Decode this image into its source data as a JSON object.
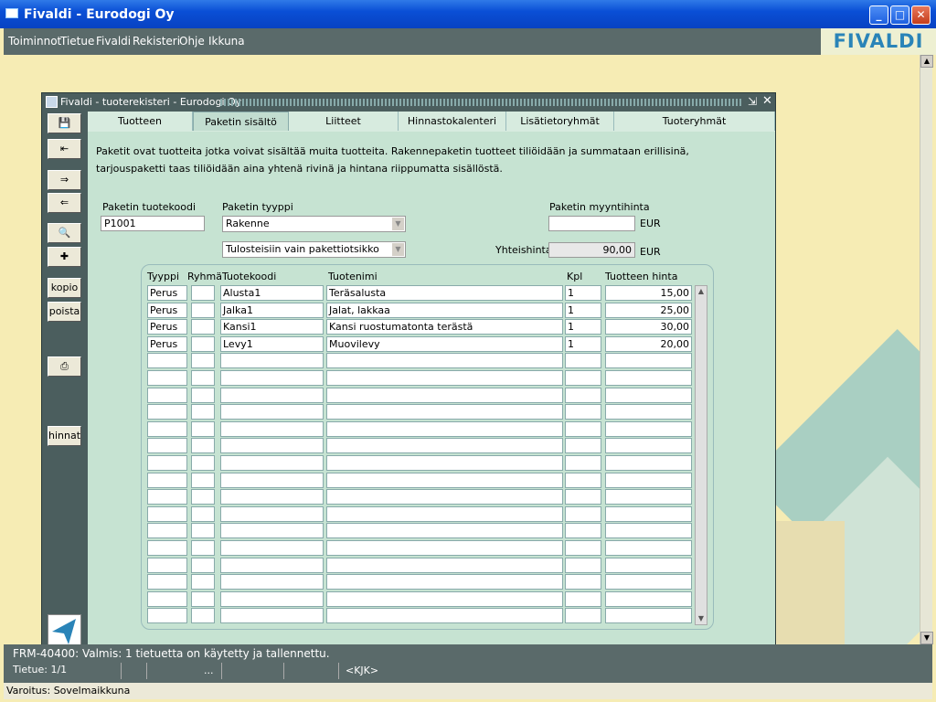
{
  "window": {
    "title": "Fivaldi - Eurodogi Oy",
    "minimize": "_",
    "maximize": "□",
    "close": "✕"
  },
  "menu": [
    "Toiminnot",
    "Tietue",
    "Fivaldi",
    "Rekisteri",
    "Ohje",
    "Ikkuna"
  ],
  "brand": {
    "logo": "FIVALDI"
  },
  "subwindow": {
    "title": "Fivaldi - tuoterekisteri - Eurodogi Oy"
  },
  "toolbar": {
    "copy": "kopio",
    "delete": "poista",
    "prices": "hinnat"
  },
  "tabs": [
    "Tuotteen perustiedot",
    "Paketin sisältö",
    "Liitteet",
    "Hinnastokalenteri",
    "Lisätietoryhmät",
    "Tuoteryhmät"
  ],
  "description": {
    "line1": "Paketit ovat tuotteita jotka voivat sisältää muita tuotteita. Rakennepaketin tuotteet tiliöidään ja summataan erillisinä,",
    "line2": "tarjouspaketti taas tiliöidään aina yhtenä rivinä ja hintana riippumatta sisällöstä."
  },
  "form": {
    "code_label": "Paketin tuotekoodi",
    "code_value": "P1001",
    "type_label": "Paketin tyyppi",
    "type_value": "Rakenne",
    "print_value": "Tulosteisiin vain pakettiotsikko",
    "sale_label": "Paketin myyntihinta",
    "sale_value": "",
    "currency": "EUR",
    "total_label": "Yhteishinta",
    "total_value": "90,00",
    "total_currency": "EUR"
  },
  "grid": {
    "headers": [
      "Tyyppi",
      "Ryhmä",
      "Tuotekoodi",
      "Tuotenimi",
      "Kpl",
      "Tuotteen hinta"
    ],
    "rows": [
      [
        "Perus",
        "",
        "Alusta1",
        "Teräsalusta",
        "1",
        "15,00"
      ],
      [
        "Perus",
        "",
        "Jalka1",
        "Jalat, lakkaa",
        "1",
        "25,00"
      ],
      [
        "Perus",
        "",
        "Kansi1",
        "Kansi ruostumatonta terästä",
        "1",
        "30,00"
      ],
      [
        "Perus",
        "",
        "Levy1",
        "Muovilevy",
        "1",
        "20,00"
      ]
    ],
    "empty_rows": 16
  },
  "status": {
    "message": "FRM-40400: Valmis: 1 tietuetta on käytetty ja tallennettu.",
    "record": "Tietue: 1/1",
    "ellipsis": "...",
    "mode": "<KJK>"
  },
  "warning": "Varoitus: Sovelmaikkuna"
}
